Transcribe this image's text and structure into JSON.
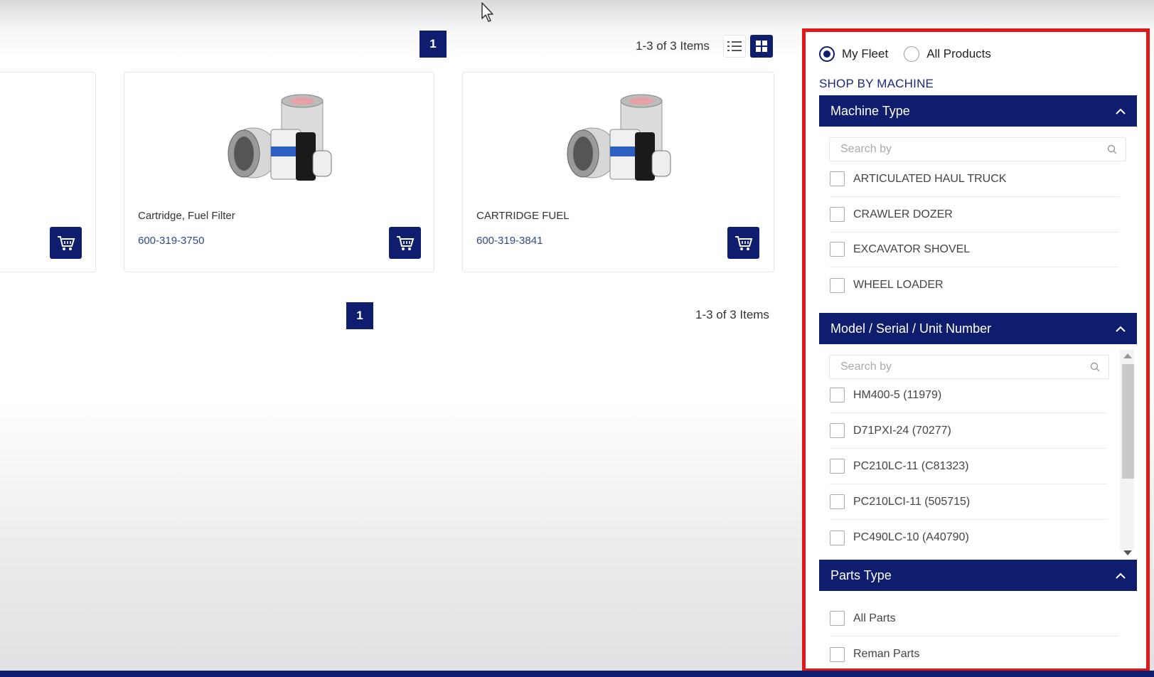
{
  "pagination_top": {
    "page": "1",
    "count_text": "1-3 of 3 Items"
  },
  "pagination_bottom": {
    "page": "1",
    "count_text": "1-3 of 3 Items"
  },
  "view_modes": {
    "active": "grid",
    "options": [
      "list-icon",
      "grid-icon"
    ]
  },
  "products": [
    {
      "name": "",
      "part_number": ""
    },
    {
      "name": "Cartridge, Fuel Filter",
      "part_number": "600-319-3750"
    },
    {
      "name": "CARTRIDGE FUEL",
      "part_number": "600-319-3841"
    }
  ],
  "sidebar": {
    "fleet_filter": {
      "options": [
        {
          "label": "My Fleet",
          "checked": true
        },
        {
          "label": "All Products",
          "checked": false
        }
      ]
    },
    "section_title": "SHOP BY MACHINE",
    "machine_type": {
      "title": "Machine Type",
      "search_placeholder": "Search by",
      "items": [
        "ARTICULATED HAUL TRUCK",
        "CRAWLER DOZER",
        "EXCAVATOR SHOVEL",
        "WHEEL LOADER"
      ]
    },
    "model_serial": {
      "title": "Model / Serial / Unit Number",
      "search_placeholder": "Search by",
      "items": [
        "HM400-5 (11979)",
        "D71PXI-24 (70277)",
        "PC210LC-11 (C81323)",
        "PC210LCI-11 (505715)",
        "PC490LC-10 (A40790)"
      ]
    },
    "parts_type": {
      "title": "Parts Type",
      "items": [
        "All Parts",
        "Reman Parts"
      ]
    }
  },
  "colors": {
    "primary": "#0f1d6e",
    "highlight_border": "#e01818",
    "part_link": "#2e4a8a"
  }
}
